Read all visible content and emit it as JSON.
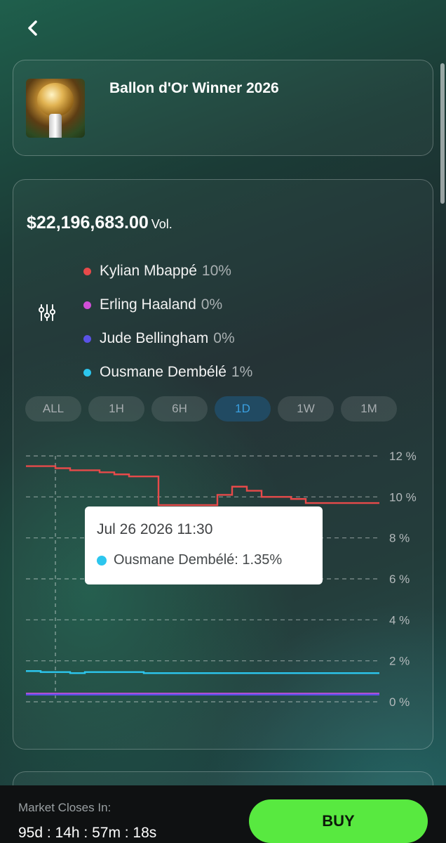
{
  "header": {
    "title": "Ballon d'Or Winner 2026",
    "back_icon": "chevron-left-icon"
  },
  "market": {
    "volume": "$22,196,683.00",
    "volume_label": "Vol.",
    "filter_icon": "sliders-icon"
  },
  "legend": [
    {
      "name": "Kylian Mbappé",
      "value": "10%",
      "color": "#e74a4a"
    },
    {
      "name": "Erling Haaland",
      "value": "0%",
      "color": "#d14fd8"
    },
    {
      "name": "Jude Bellingham",
      "value": "0%",
      "color": "#5a52e6"
    },
    {
      "name": "Ousmane Dembélé",
      "value": "1%",
      "color": "#2cc6ee"
    }
  ],
  "ranges": [
    {
      "label": "ALL",
      "active": false
    },
    {
      "label": "1H",
      "active": false
    },
    {
      "label": "6H",
      "active": false
    },
    {
      "label": "1D",
      "active": true
    },
    {
      "label": "1W",
      "active": false
    },
    {
      "label": "1M",
      "active": false
    }
  ],
  "chart_data": {
    "type": "line",
    "ylim": [
      0,
      12
    ],
    "y_ticks": [
      "12 %",
      "10 %",
      "8 %",
      "6 %",
      "4 %",
      "2 %",
      "0 %"
    ],
    "grid": true,
    "x": [
      0,
      1,
      2,
      3,
      4,
      5,
      6,
      7,
      8,
      9,
      10,
      11,
      12,
      13,
      14,
      15,
      16,
      17,
      18,
      19,
      20,
      21,
      22,
      23,
      24
    ],
    "series": [
      {
        "name": "Kylian Mbappé",
        "color": "#e74a4a",
        "values": [
          11.5,
          11.5,
          11.4,
          11.3,
          11.3,
          11.2,
          11.1,
          11.0,
          11.0,
          9.6,
          9.6,
          9.6,
          9.6,
          10.1,
          10.5,
          10.3,
          10.0,
          10.0,
          9.9,
          9.7,
          9.7,
          9.7,
          9.7,
          9.7,
          9.7
        ]
      },
      {
        "name": "Ousmane Dembélé",
        "color": "#2cc6ee",
        "values": [
          1.5,
          1.45,
          1.45,
          1.4,
          1.45,
          1.45,
          1.45,
          1.45,
          1.4,
          1.4,
          1.4,
          1.4,
          1.4,
          1.4,
          1.4,
          1.4,
          1.4,
          1.4,
          1.4,
          1.4,
          1.4,
          1.4,
          1.4,
          1.4,
          1.4
        ]
      },
      {
        "name": "Erling Haaland",
        "color": "#d14fd8",
        "values": [
          0.4,
          0.4,
          0.4,
          0.4,
          0.4,
          0.4,
          0.4,
          0.4,
          0.4,
          0.4,
          0.4,
          0.4,
          0.4,
          0.4,
          0.4,
          0.4,
          0.4,
          0.4,
          0.4,
          0.4,
          0.4,
          0.4,
          0.4,
          0.4,
          0.4
        ]
      },
      {
        "name": "Jude Bellingham",
        "color": "#5a52e6",
        "values": [
          0.35,
          0.35,
          0.35,
          0.35,
          0.35,
          0.35,
          0.35,
          0.35,
          0.35,
          0.35,
          0.35,
          0.35,
          0.35,
          0.35,
          0.35,
          0.35,
          0.35,
          0.35,
          0.35,
          0.35,
          0.35,
          0.35,
          0.35,
          0.35,
          0.35
        ]
      }
    ],
    "crosshair_x": 2
  },
  "tooltip": {
    "time": "Jul 26 2026 11:30",
    "text": "Ousmane Dembélé: 1.35%"
  },
  "footer": {
    "closes_label": "Market Closes In:",
    "countdown": "95d : 14h : 57m : 18s",
    "buy_label": "BUY"
  }
}
